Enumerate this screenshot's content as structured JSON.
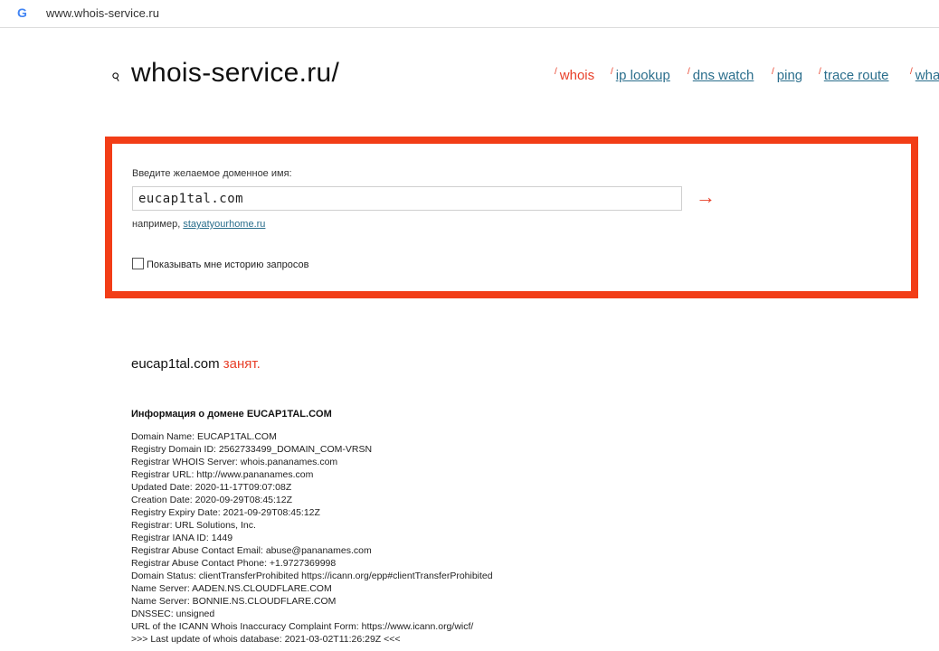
{
  "browser": {
    "url": "www.whois-service.ru",
    "favicon_letter": "G"
  },
  "site": {
    "logo_text": "whois-service.ru/"
  },
  "nav": [
    {
      "slash": "/",
      "label": "whois"
    },
    {
      "slash": "/",
      "label": "ip lookup"
    },
    {
      "slash": "/",
      "label": "dns watch"
    },
    {
      "slash": "/",
      "label": "ping"
    },
    {
      "slash": "/",
      "label": "trace route"
    },
    {
      "slash": "/",
      "label": "wha"
    }
  ],
  "search": {
    "prompt": "Введите желаемое доменное имя:",
    "value": "eucap1tal.com",
    "example_prefix": "например, ",
    "example_link": "stayatyourhome.ru",
    "history_label": "Показывать мне историю запросов",
    "submit_arrow": "→"
  },
  "result": {
    "domain": "eucap1tal.com",
    "status": "занят."
  },
  "whois": {
    "title": "Информация о домене EUCAP1TAL.COM",
    "lines": [
      "Domain Name: EUCAP1TAL.COM",
      "Registry Domain ID: 2562733499_DOMAIN_COM-VRSN",
      "Registrar WHOIS Server: whois.pananames.com",
      "Registrar URL: http://www.pananames.com",
      "Updated Date: 2020-11-17T09:07:08Z",
      "Creation Date: 2020-09-29T08:45:12Z",
      "Registry Expiry Date: 2021-09-29T08:45:12Z",
      "Registrar: URL Solutions, Inc.",
      "Registrar IANA ID: 1449",
      "Registrar Abuse Contact Email: abuse@pananames.com",
      "Registrar Abuse Contact Phone: +1.9727369998",
      "Domain Status: clientTransferProhibited https://icann.org/epp#clientTransferProhibited",
      "Name Server: AADEN.NS.CLOUDFLARE.COM",
      "Name Server: BONNIE.NS.CLOUDFLARE.COM",
      "DNSSEC: unsigned",
      "URL of the ICANN Whois Inaccuracy Complaint Form: https://www.icann.org/wicf/",
      ">>> Last update of whois database: 2021-03-02T11:26:29Z <<<"
    ]
  }
}
